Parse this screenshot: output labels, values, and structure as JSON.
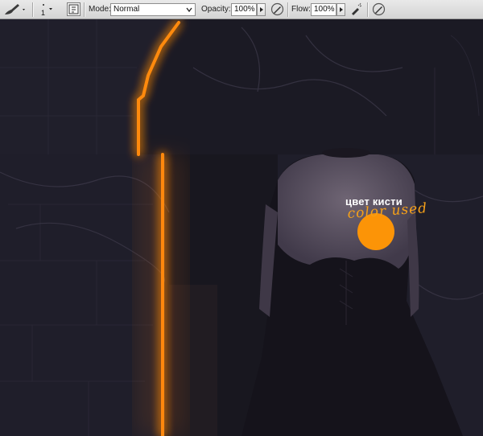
{
  "options_bar": {
    "brush_size": "1",
    "mode_label": "Mode:",
    "mode_value": "Normal",
    "opacity_label": "Opacity:",
    "opacity_value": "100%",
    "flow_label": "Flow:",
    "flow_value": "100%"
  },
  "canvas": {
    "annotation_ru": "цвет кисти",
    "annotation_en": "color used",
    "brush_color": "#fc9407",
    "glow_color": "#ff8a10"
  }
}
